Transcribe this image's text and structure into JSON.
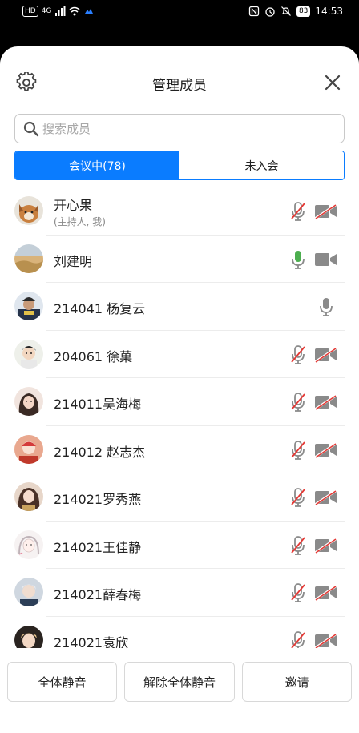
{
  "status_bar": {
    "hd": "HD",
    "network": "4G",
    "battery": "83",
    "time": "14:53"
  },
  "header": {
    "title": "管理成员"
  },
  "search": {
    "placeholder": "搜索成员"
  },
  "tabs": [
    {
      "label": "会议中(78)"
    },
    {
      "label": "未入会"
    }
  ],
  "members": [
    {
      "name": "开心果",
      "sub": "(主持人, 我)",
      "mic": "muted",
      "cam": "off"
    },
    {
      "name": "刘建明",
      "mic": "on",
      "cam": "on"
    },
    {
      "name": "214041 杨复云",
      "mic": "idle",
      "cam": "none"
    },
    {
      "name": "204061 徐菓",
      "mic": "muted",
      "cam": "off"
    },
    {
      "name": "214011吴海梅",
      "mic": "muted",
      "cam": "off"
    },
    {
      "name": "214012 赵志杰",
      "mic": "muted",
      "cam": "off"
    },
    {
      "name": "214021罗秀燕",
      "mic": "muted",
      "cam": "off"
    },
    {
      "name": "214021王佳静",
      "mic": "muted",
      "cam": "off"
    },
    {
      "name": "214021薛春梅",
      "mic": "muted",
      "cam": "off"
    },
    {
      "name": "214021袁欣",
      "mic": "muted",
      "cam": "off"
    }
  ],
  "footer": {
    "mute_all": "全体静音",
    "unmute_all": "解除全体静音",
    "invite": "邀请"
  },
  "colors": {
    "accent": "#0a7cff",
    "mic_on": "#4cae4f",
    "muted_red": "#e53935",
    "icon_grey": "#8a8a8a"
  }
}
